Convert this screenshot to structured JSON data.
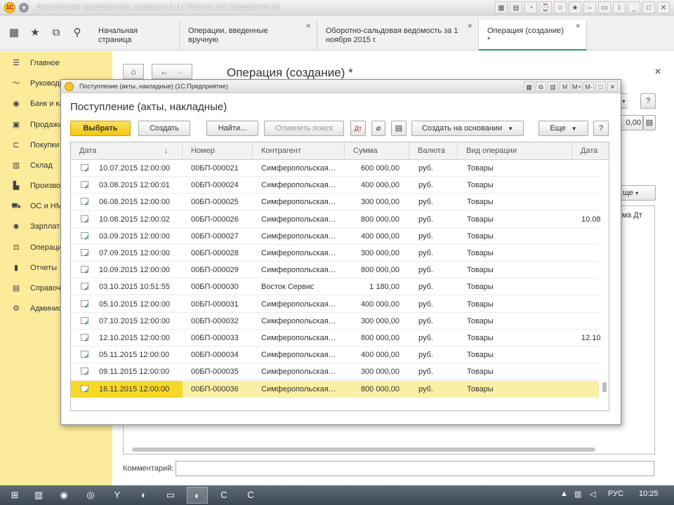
{
  "window": {
    "title": "Бухгалтерия предприятия, редакция 3.0 / Ларчев (1С:Предприятие)"
  },
  "topnav": {
    "tabs": [
      {
        "label": "Начальная страница",
        "closable": false,
        "active": false
      },
      {
        "label": "Операции, введенные вручную",
        "closable": true,
        "active": false
      },
      {
        "label": "Оборотно-сальдовая ведомость за 1 ноября 2015 г.",
        "closable": true,
        "active": false
      },
      {
        "label": "Операция (создание) *",
        "closable": true,
        "active": true
      }
    ]
  },
  "sidebar": {
    "items": [
      {
        "label": "Главное",
        "icon": "menu-lines-icon"
      },
      {
        "label": "Руководителю",
        "icon": "trend-icon"
      },
      {
        "label": "Банк и касса",
        "icon": "bank-icon"
      },
      {
        "label": "Продажи",
        "icon": "bag-icon"
      },
      {
        "label": "Покупки",
        "icon": "cart-icon"
      },
      {
        "label": "Склад",
        "icon": "boxes-icon"
      },
      {
        "label": "Производство",
        "icon": "factory-icon"
      },
      {
        "label": "ОС и НМА",
        "icon": "truck-icon"
      },
      {
        "label": "Зарплата и кадры",
        "icon": "person-icon"
      },
      {
        "label": "Операции",
        "icon": "operations-icon"
      },
      {
        "label": "Отчеты",
        "icon": "chart-icon"
      },
      {
        "label": "Справочники",
        "icon": "books-icon"
      },
      {
        "label": "Администрирование",
        "icon": "gear-icon"
      }
    ]
  },
  "background_form": {
    "title": "Операция (создание) *",
    "comment_label": "Комментарий:",
    "amount_value": "0,00",
    "help_label": "?",
    "more_label": "ще",
    "column_fragment": "мма Дт"
  },
  "modal": {
    "window_title": "Поступление (акты, накладные)  (1С:Предприятие)",
    "heading": "Поступление (акты, накладные)",
    "buttons": {
      "select": "Выбрать",
      "create": "Создать",
      "find": "Найти...",
      "cancel_search": "Отменить поиск",
      "create_based_on": "Создать на основании",
      "more": "Еще",
      "help": "?"
    },
    "table": {
      "columns": [
        "Дата",
        "Номер",
        "Контрагент",
        "Сумма",
        "Валюта",
        "Вид операции",
        "Дата"
      ],
      "rows": [
        {
          "date": "10.07.2015 12:00:00",
          "number": "00БП-000021",
          "counterparty": "Симферопольская…",
          "amount": "600 000,00",
          "currency": "руб.",
          "operation": "Товары",
          "date2": ""
        },
        {
          "date": "03.08.2015 12:00:01",
          "number": "00БП-000024",
          "counterparty": "Симферопольская…",
          "amount": "400 000,00",
          "currency": "руб.",
          "operation": "Товары",
          "date2": ""
        },
        {
          "date": "06.08.2015 12:00:00",
          "number": "00БП-000025",
          "counterparty": "Симферопольская…",
          "amount": "300 000,00",
          "currency": "руб.",
          "operation": "Товары",
          "date2": ""
        },
        {
          "date": "10.08.2015 12:00:02",
          "number": "00БП-000026",
          "counterparty": "Симферопольская…",
          "amount": "800 000,00",
          "currency": "руб.",
          "operation": "Товары",
          "date2": "10.08"
        },
        {
          "date": "03.09.2015 12:00:00",
          "number": "00БП-000027",
          "counterparty": "Симферопольская…",
          "amount": "400 000,00",
          "currency": "руб.",
          "operation": "Товары",
          "date2": ""
        },
        {
          "date": "07.09.2015 12:00:00",
          "number": "00БП-000028",
          "counterparty": "Симферопольская…",
          "amount": "300 000,00",
          "currency": "руб.",
          "operation": "Товары",
          "date2": ""
        },
        {
          "date": "10.09.2015 12:00:00",
          "number": "00БП-000029",
          "counterparty": "Симферопольская…",
          "amount": "800 000,00",
          "currency": "руб.",
          "operation": "Товары",
          "date2": ""
        },
        {
          "date": "03.10.2015 10:51:55",
          "number": "00БП-000030",
          "counterparty": "Восток Сервис",
          "amount": "1 180,00",
          "currency": "руб.",
          "operation": "Товары",
          "date2": ""
        },
        {
          "date": "05.10.2015 12:00:00",
          "number": "00БП-000031",
          "counterparty": "Симферопольская…",
          "amount": "400 000,00",
          "currency": "руб.",
          "operation": "Товары",
          "date2": ""
        },
        {
          "date": "07.10.2015 12:00:00",
          "number": "00БП-000032",
          "counterparty": "Симферопольская…",
          "amount": "300 000,00",
          "currency": "руб.",
          "operation": "Товары",
          "date2": ""
        },
        {
          "date": "12.10.2015 12:00:00",
          "number": "00БП-000033",
          "counterparty": "Симферопольская…",
          "amount": "800 000,00",
          "currency": "руб.",
          "operation": "Товары",
          "date2": "12.10"
        },
        {
          "date": "05.11.2015 12:00:00",
          "number": "00БП-000034",
          "counterparty": "Симферопольская…",
          "amount": "400 000,00",
          "currency": "руб.",
          "operation": "Товары",
          "date2": ""
        },
        {
          "date": "09.11.2015 12:00:00",
          "number": "00БП-000035",
          "counterparty": "Симферопольская…",
          "amount": "300 000,00",
          "currency": "руб.",
          "operation": "Товары",
          "date2": ""
        },
        {
          "date": "16.11.2015 12:00:00",
          "number": "00БП-000036",
          "counterparty": "Симферопольская…",
          "amount": "800 000,00",
          "currency": "руб.",
          "operation": "Товары",
          "date2": ""
        }
      ],
      "selected_row": 13
    }
  },
  "taskbar": {
    "language": "РУС",
    "clock": "10:25"
  },
  "colors": {
    "sidebar_bg": "#fbeb9a",
    "primary_button": "#f1c60f",
    "selected_row": "#faf0a5",
    "active_tab_accent": "#2a9b6a"
  }
}
